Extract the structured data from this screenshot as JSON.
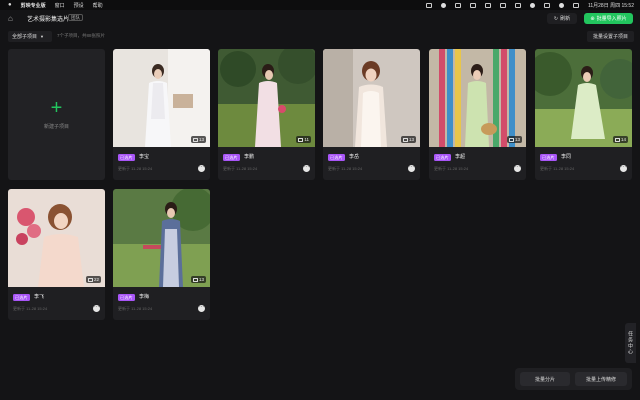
{
  "menubar": {
    "app": "剪映专业版",
    "items": [
      "窗口",
      "预设",
      "帮助"
    ],
    "datetime": "11月28日 周四 15:52"
  },
  "topbar": {
    "title": "艺术摄影集选片",
    "badge": "团队",
    "refresh": "刷新",
    "import": "批量导入照片"
  },
  "filter": {
    "dropdown": "全部子项目",
    "summary": "7个子项目，共88张照片",
    "batch_cover": "批量设置子项目"
  },
  "new_card": {
    "label": "新建子项目"
  },
  "cards": [
    {
      "name": "李宝",
      "tag": "已选片",
      "count": "13",
      "meta": "更新于 11-28 15:24"
    },
    {
      "name": "李鹏",
      "tag": "已选片",
      "count": "11",
      "meta": "更新于 11-28 15:24"
    },
    {
      "name": "李岳",
      "tag": "已选片",
      "count": "13",
      "meta": "更新于 11-28 15:24"
    },
    {
      "name": "李超",
      "tag": "已选片",
      "count": "13",
      "meta": "更新于 11-28 15:24"
    },
    {
      "name": "李同",
      "tag": "已选片",
      "count": "14",
      "meta": "更新于 11-28 15:24"
    },
    {
      "name": "李飞",
      "tag": "已选片",
      "count": "22",
      "meta": "更新于 11-28 15:24"
    },
    {
      "name": "李梅",
      "tag": "已选片",
      "count": "13",
      "meta": "更新于 11-28 15:24"
    }
  ],
  "side": {
    "task_center": "任务中心"
  },
  "bottom": {
    "split": "批量分片",
    "upload": "批量上传精修"
  },
  "colors": {
    "accent": "#22c55e",
    "tag": "#a855f7",
    "bg": "#141416"
  }
}
